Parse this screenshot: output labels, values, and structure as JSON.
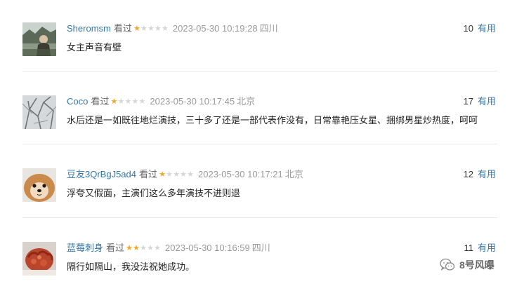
{
  "reviews": [
    {
      "username": "Sheromsm",
      "status": "看过",
      "rating": 1,
      "time": "2023-05-30 10:19:28",
      "location": "四川",
      "votes": "10",
      "vote_label": "有用",
      "content": "女主声音有壁"
    },
    {
      "username": "Coco",
      "status": "看过",
      "rating": 1,
      "time": "2023-05-30 10:17:45",
      "location": "北京",
      "votes": "17",
      "vote_label": "有用",
      "content": "水后还是一如既往地烂演技，三十多了还是一部代表作没有，日常靠艳压女星、捆绑男星炒热度，呵呵"
    },
    {
      "username": "豆友3QrBgJ5ad4",
      "status": "看过",
      "rating": 1,
      "time": "2023-05-30 10:17:21",
      "location": "北京",
      "votes": "12",
      "vote_label": "有用",
      "content": "浮夸又假面，主演们这么多年演技不进则退"
    },
    {
      "username": "蓝莓刺身",
      "status": "看过",
      "rating": 2,
      "time": "2023-05-30 10:16:59",
      "location": "四川",
      "votes": "11",
      "vote_label": "有用",
      "content": "隔行如隔山，我没法祝她成功。"
    }
  ],
  "watermark": {
    "text": "8号风曝"
  },
  "colors": {
    "link": "#3377aa",
    "star_on": "#f5a623",
    "star_off": "#d6d6d6",
    "meta_gray": "#999999"
  }
}
